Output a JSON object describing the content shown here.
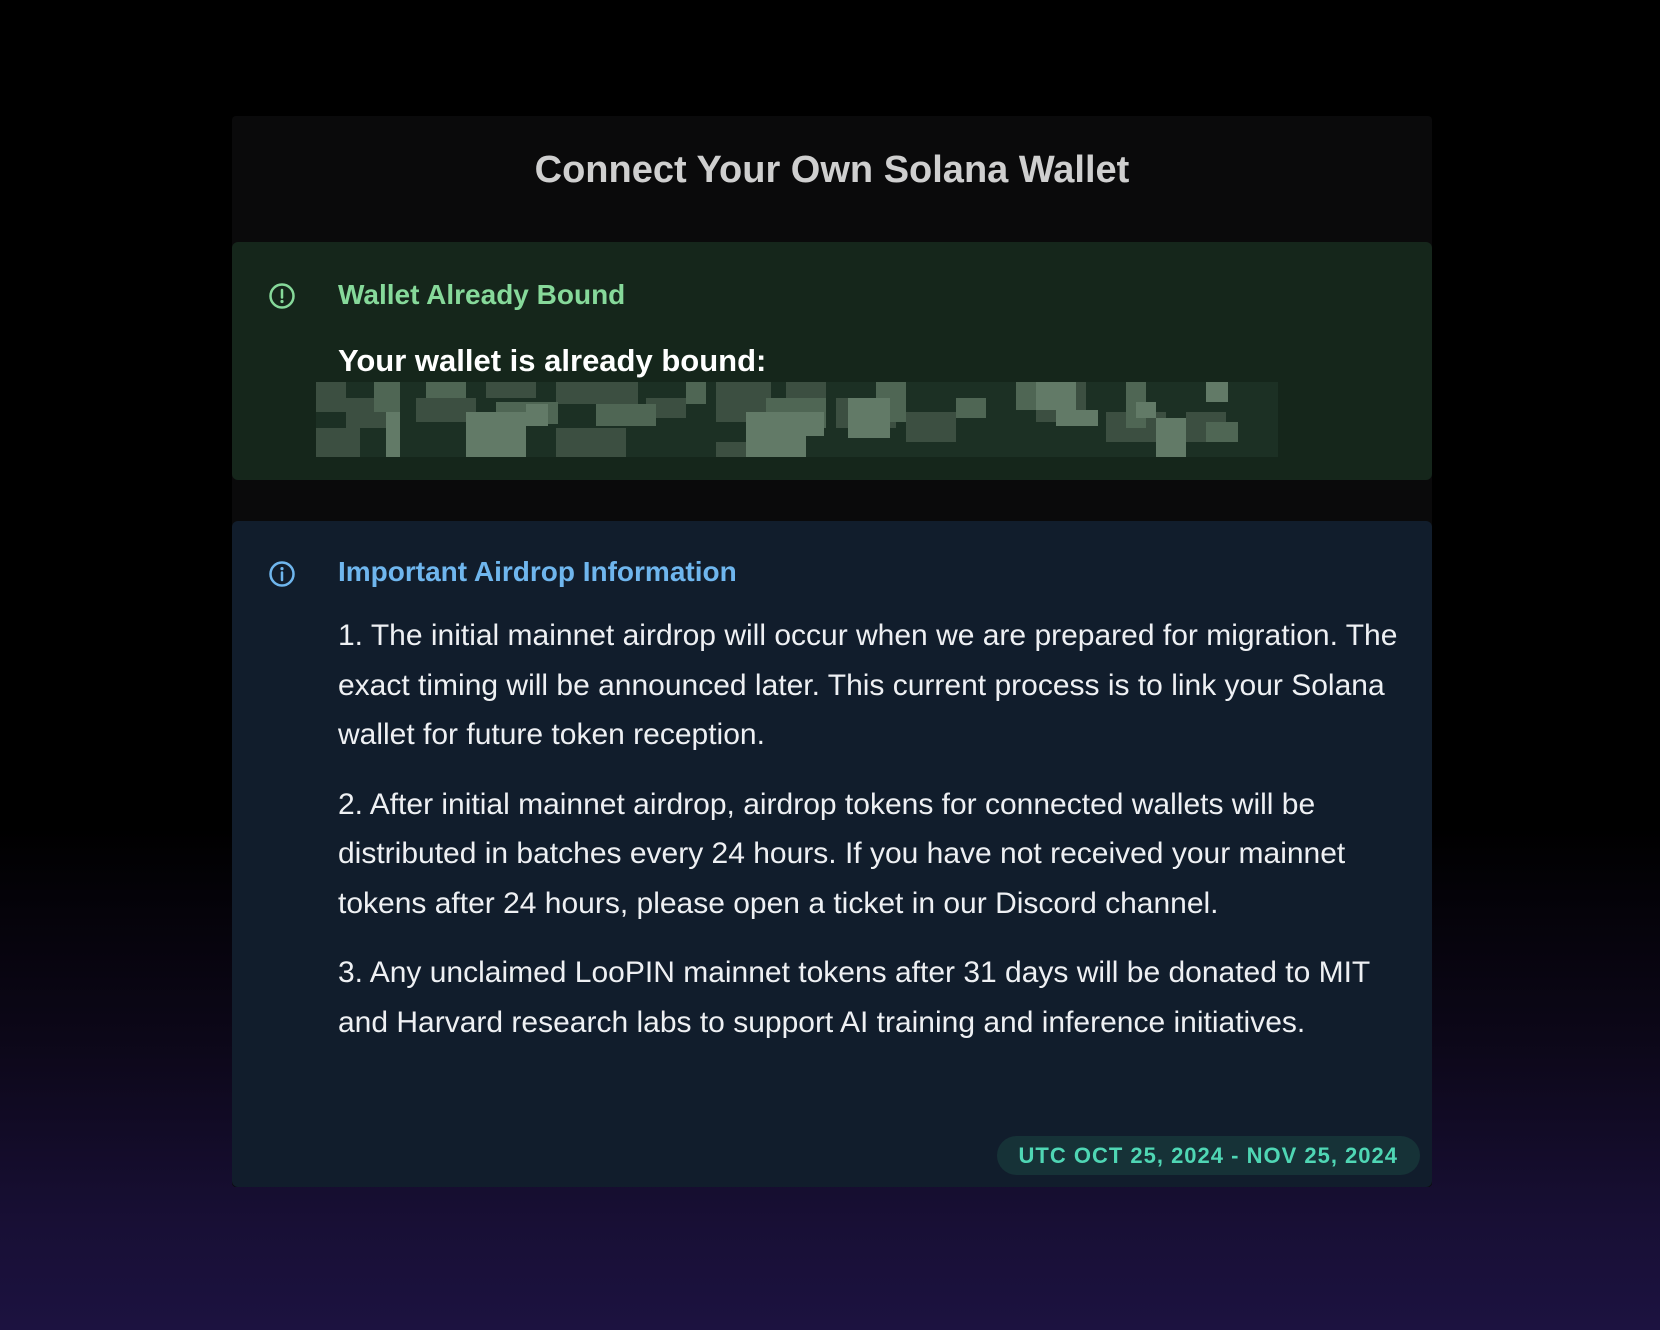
{
  "title": "Connect Your Own Solana Wallet",
  "bound_alert": {
    "icon": "alert-circle-icon",
    "heading": "Wallet Already Bound",
    "label": "Your wallet is already bound:",
    "address_redacted": true
  },
  "info_alert": {
    "icon": "info-circle-icon",
    "heading": "Important Airdrop Information",
    "items": [
      "1. The initial mainnet airdrop will occur when we are prepared for migration. The exact timing will be announced later. This current process is to link your Solana wallet for future token reception.",
      "2. After initial mainnet airdrop, airdrop tokens for connected wallets will be distributed in batches every 24 hours. If you have not received your mainnet tokens after 24 hours, please open a ticket in our Discord channel.",
      "3. Any unclaimed LooPIN mainnet tokens after 31 days will be donated to MIT and Harvard research labs to support AI training and inference initiatives."
    ],
    "date_range": "UTC OCT 25, 2024 - NOV 25, 2024"
  },
  "colors": {
    "success_text": "#86d99a",
    "success_bg": "#15261b",
    "info_text": "#6fb6ee",
    "info_bg": "#111d2c",
    "pill_text": "#4fd6b4",
    "pill_bg": "#163237"
  }
}
